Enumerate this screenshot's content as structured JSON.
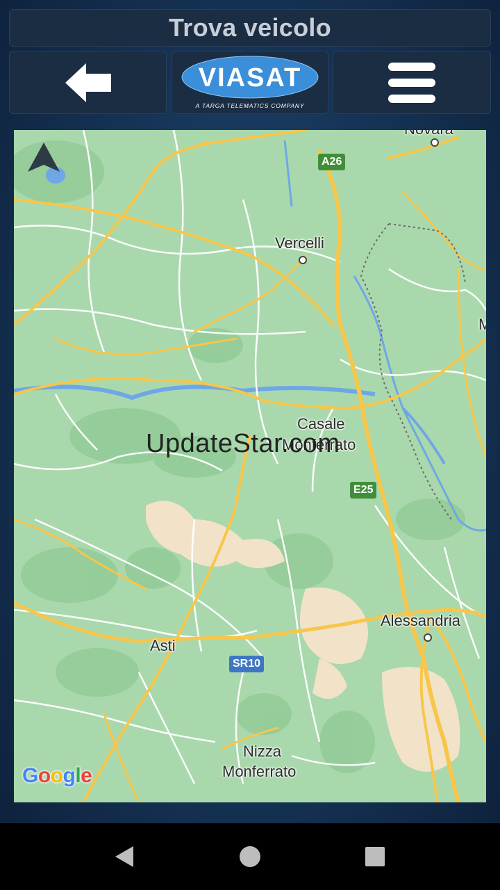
{
  "header": {
    "title": "Trova veicolo"
  },
  "toolbar": {
    "back_icon": "arrow-left-icon",
    "logo_text": "VIASAT",
    "logo_tagline": "A TARGA TELEMATICS COMPANY",
    "menu_icon": "hamburger-menu-icon"
  },
  "map": {
    "places": [
      {
        "id": "novara",
        "name": "Novara"
      },
      {
        "id": "vercelli",
        "name": "Vercelli"
      },
      {
        "id": "casale1",
        "name": "Casale"
      },
      {
        "id": "casale2",
        "name": "Monferrato"
      },
      {
        "id": "alessandria",
        "name": "Alessandria"
      },
      {
        "id": "asti",
        "name": "Asti"
      },
      {
        "id": "nizza1",
        "name": "Nizza"
      },
      {
        "id": "nizza2",
        "name": "Monferrato"
      },
      {
        "id": "edge_m",
        "name": "M"
      }
    ],
    "road_shields": [
      {
        "id": "a26",
        "label": "A26"
      },
      {
        "id": "e25",
        "label": "E25"
      },
      {
        "id": "sr10",
        "label": "SR10"
      }
    ],
    "watermark": "UpdateStar.com",
    "attribution": {
      "G": "G",
      "o1": "o",
      "o2": "o",
      "g": "g",
      "l": "l",
      "e": "e"
    },
    "colors": {
      "land": "#a9d8ad",
      "road_major": "#f7c64a",
      "road_minor": "#ffffff",
      "water": "#6fa7e6",
      "urban": "#f2e3c8"
    }
  },
  "system_nav": {
    "back": "back-triangle-icon",
    "home": "home-circle-icon",
    "recents": "recents-square-icon"
  }
}
